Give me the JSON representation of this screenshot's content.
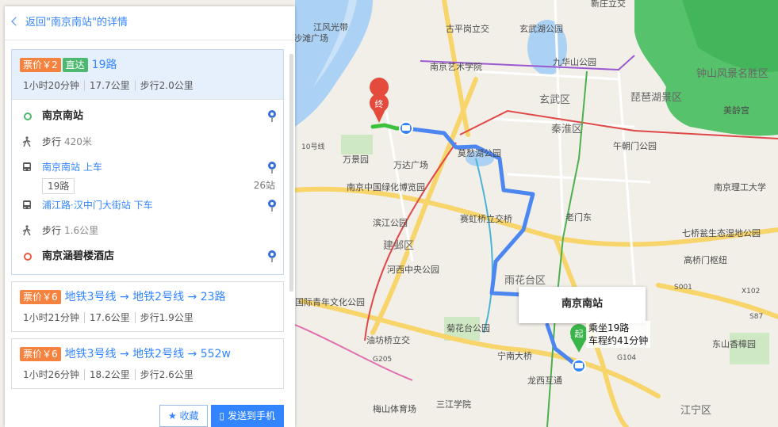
{
  "panel": {
    "back_label": "返回\"南京南站\"的详情"
  },
  "routes": [
    {
      "fare": "票价￥2",
      "direct": "直达",
      "name": "19路",
      "time": "1小时20分钟",
      "distance": "17.7公里",
      "walk": "步行2.0公里"
    },
    {
      "fare": "票价￥6",
      "name": "地铁3号线 → 地铁2号线 → 23路",
      "time": "1小时21分钟",
      "distance": "17.6公里",
      "walk": "步行1.9公里"
    },
    {
      "fare": "票价￥6",
      "name": "地铁3号线 → 地铁2号线 → 552w",
      "time": "1小时26分钟",
      "distance": "18.2公里",
      "walk": "步行2.6公里"
    }
  ],
  "steps": {
    "start": "南京南站",
    "walk1": "步行",
    "walk1_dist": "420米",
    "board": "南京南站 上车",
    "line": "19路",
    "stops": "26站",
    "alight": "浦江路·汉中门大街站 下车",
    "walk2": "步行",
    "walk2_dist": "1.6公里",
    "end": "南京涵碧楼酒店"
  },
  "buttons": {
    "favorite": "收藏",
    "send": "发送到手机"
  },
  "map": {
    "station_card": "南京南站",
    "start_marker": "起",
    "end_marker": "终",
    "annotation_line1": "乘坐19路",
    "annotation_line2": "车程约41分钟",
    "labels": [
      {
        "t": "新庄立交"
      },
      {
        "t": "江风光带"
      },
      {
        "t": "沙滩广场"
      },
      {
        "t": "古平岗立交"
      },
      {
        "t": "玄武湖公园"
      },
      {
        "t": "九华山公园"
      },
      {
        "t": "钟山风景名胜区"
      },
      {
        "t": "南京艺术学院"
      },
      {
        "t": "玄武区"
      },
      {
        "t": "琵琶湖景区"
      },
      {
        "t": "秦淮区"
      },
      {
        "t": "美龄宫"
      },
      {
        "t": "午朝门公园"
      },
      {
        "t": "10号线"
      },
      {
        "t": "万景园"
      },
      {
        "t": "万达广场"
      },
      {
        "t": "莫愁湖公园"
      },
      {
        "t": "南京中国绿化博览园"
      },
      {
        "t": "南京理工大学"
      },
      {
        "t": "老门东"
      },
      {
        "t": "滨江公园"
      },
      {
        "t": "赛虹桥立交桥"
      },
      {
        "t": "建邺区"
      },
      {
        "t": "七桥瓮生态湿地公园"
      },
      {
        "t": "高桥门枢纽"
      },
      {
        "t": "河西中央公园"
      },
      {
        "t": "雨花台区"
      },
      {
        "t": "S001"
      },
      {
        "t": "X102"
      },
      {
        "t": "国际青年文化公园"
      },
      {
        "t": "S87"
      },
      {
        "t": "菊花台公园"
      },
      {
        "t": "油坊桥立交"
      },
      {
        "t": "G104"
      },
      {
        "t": "东山香樟园"
      },
      {
        "t": "宁南大桥"
      },
      {
        "t": "G205"
      },
      {
        "t": "龙西互通"
      },
      {
        "t": "梅山体育场"
      },
      {
        "t": "三江学院"
      },
      {
        "t": "江宁区"
      }
    ]
  },
  "colors": {
    "accent": "#3385ff",
    "fare": "#f5833f",
    "direct": "#4db870",
    "route_line": "#4c86f0",
    "walk_line": "#3cc13c"
  }
}
